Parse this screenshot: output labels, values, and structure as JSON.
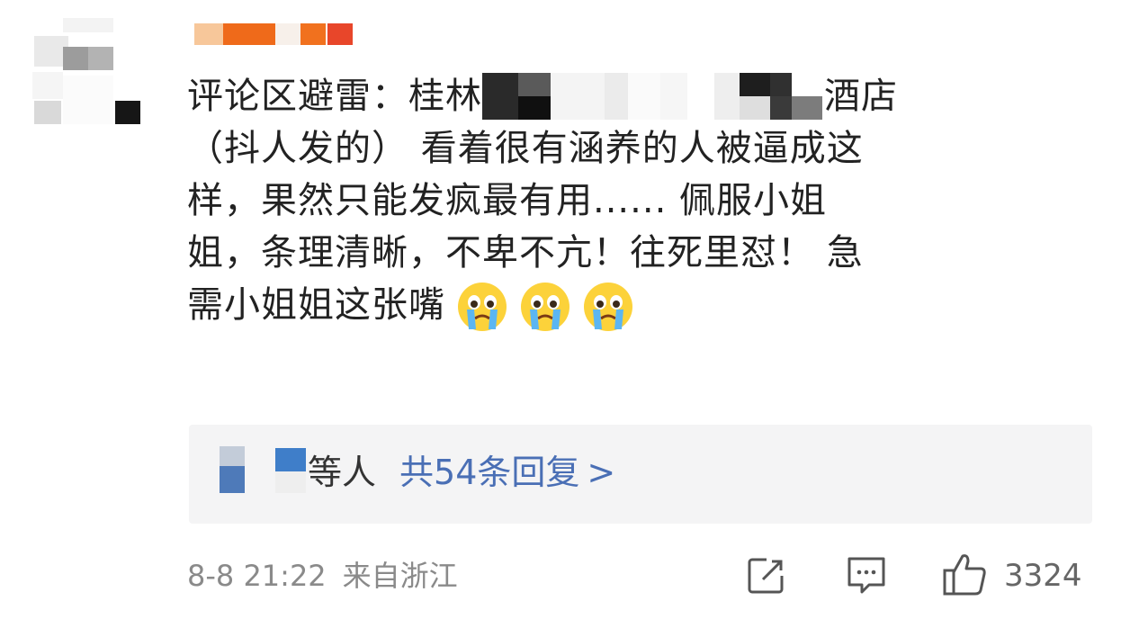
{
  "comment": {
    "line1_prefix": "评论区避雷：桂林",
    "line1_suffix": "酒店",
    "line2": "（抖人发的） 看着很有涵养的人被逼成这",
    "line3": "样，果然只能发疯最有用...... 佩服小姐",
    "line4": "姐，条理清晰，不卑不亢！往死里怼！ 急",
    "line5": "需小姐姐这张嘴",
    "emoji_icon": "crying-face-icon"
  },
  "replies": {
    "suffix": "等人",
    "link": "共54条回复",
    "arrow": ">"
  },
  "footer": {
    "date": "8-8 21:22",
    "location": "来自浙江",
    "likes": "3324"
  },
  "colors": {
    "link": "#4a6fb5",
    "meta": "#8a8a8a",
    "text": "#222222",
    "reply_bg": "#f4f4f5",
    "username_orange": "#ef6a1a",
    "username_red": "#e8462a"
  }
}
